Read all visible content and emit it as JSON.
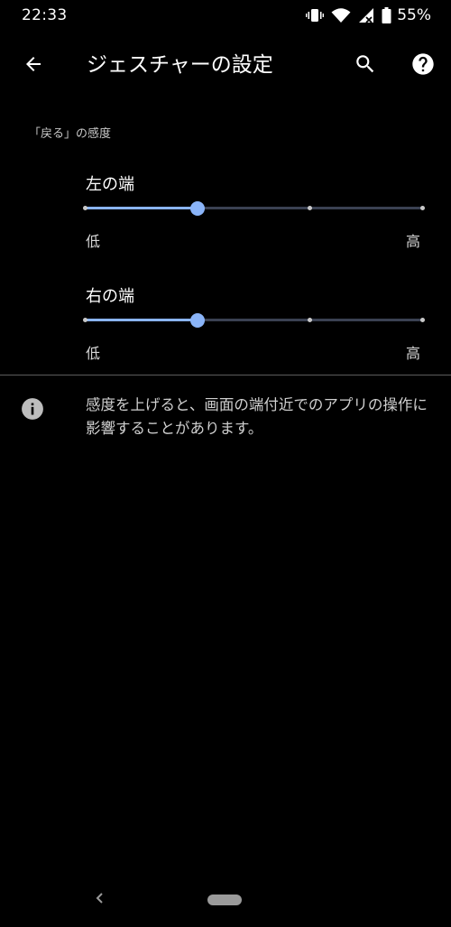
{
  "status_bar": {
    "time": "22:33",
    "battery_percent": "55%",
    "icons": [
      "vibrate-icon",
      "wifi-icon",
      "signal-icon",
      "battery-icon"
    ]
  },
  "app_bar": {
    "title": "ジェスチャーの設定",
    "back_icon": "arrow-back-icon",
    "search_icon": "search-icon",
    "help_icon": "help-icon"
  },
  "section": {
    "title": "「戻る」の感度"
  },
  "sliders": [
    {
      "label": "左の端",
      "min_label": "低",
      "max_label": "高",
      "steps": 4,
      "value_index": 1
    },
    {
      "label": "右の端",
      "min_label": "低",
      "max_label": "高",
      "steps": 4,
      "value_index": 1
    }
  ],
  "info": {
    "icon": "info-icon",
    "text": "感度を上げると、画面の端付近でのアプリの操作に影響することがあります。"
  },
  "nav_bar": {
    "back_icon": "nav-back-icon",
    "home_icon": "home-pill-icon"
  },
  "colors": {
    "background": "#000000",
    "accent": "#8ab4f8",
    "track_inactive": "#3a4152",
    "text_primary": "#ffffff",
    "text_secondary": "#c8c8c8"
  }
}
